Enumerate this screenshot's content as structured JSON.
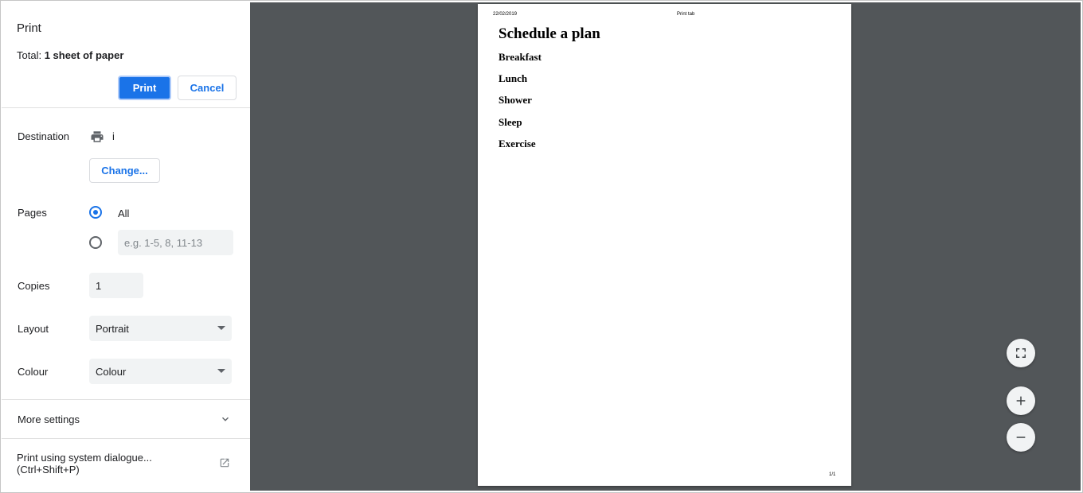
{
  "sidebar": {
    "title": "Print",
    "total_prefix": "Total: ",
    "total_value": "1 sheet of paper",
    "print_button": "Print",
    "cancel_button": "Cancel",
    "destination": {
      "label": "Destination",
      "icon": "printer-icon",
      "value": "i",
      "change_button": "Change..."
    },
    "pages": {
      "label": "Pages",
      "option_all": "All",
      "all_selected": true,
      "custom_placeholder": "e.g. 1-5, 8, 11-13"
    },
    "copies": {
      "label": "Copies",
      "value": "1"
    },
    "layout": {
      "label": "Layout",
      "selected": "Portrait"
    },
    "colour": {
      "label": "Colour",
      "selected": "Colour"
    },
    "more_settings": "More settings",
    "system_dialogue_line1": "Print using system dialogue...",
    "system_dialogue_line2": "(Ctrl+Shift+P)"
  },
  "preview": {
    "header_date": "22/02/2019",
    "header_title": "Print tab",
    "heading": "Schedule a plan",
    "items": [
      "Breakfast",
      "Lunch",
      "Shower",
      "Sleep",
      "Exercise"
    ],
    "page_number": "1/1",
    "controls": [
      "fit-to-page-icon",
      "zoom-in-icon",
      "zoom-out-icon"
    ]
  },
  "colors": {
    "accent": "#1a73e8",
    "preview_background": "#525659",
    "field_background": "#f1f3f4"
  }
}
